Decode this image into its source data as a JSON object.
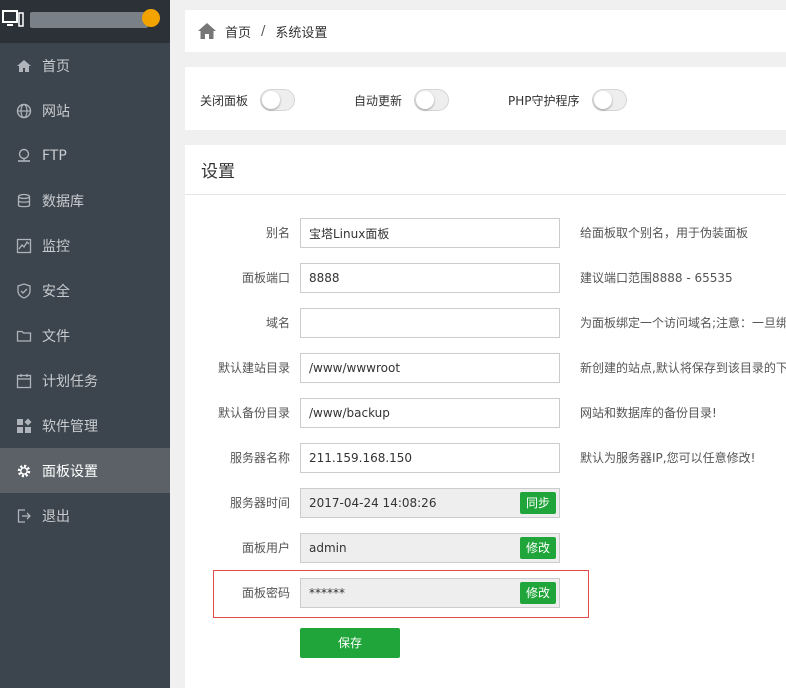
{
  "colors": {
    "sidebar": "#3c444d",
    "sidebar_top": "#2c3138",
    "active": "#5b6167",
    "accent": "#20a53a",
    "highlight": "#e14b4b"
  },
  "sidebar": {
    "items": [
      {
        "label": "首页",
        "icon": "home-icon"
      },
      {
        "label": "网站",
        "icon": "globe-icon"
      },
      {
        "label": "FTP",
        "icon": "ftp-icon"
      },
      {
        "label": "数据库",
        "icon": "database-icon"
      },
      {
        "label": "监控",
        "icon": "monitor-icon"
      },
      {
        "label": "安全",
        "icon": "shield-icon"
      },
      {
        "label": "文件",
        "icon": "folder-icon"
      },
      {
        "label": "计划任务",
        "icon": "calendar-icon"
      },
      {
        "label": "软件管理",
        "icon": "apps-icon"
      },
      {
        "label": "面板设置",
        "icon": "gear-icon",
        "active": true
      },
      {
        "label": "退出",
        "icon": "logout-icon"
      }
    ]
  },
  "breadcrumb": {
    "home": "首页",
    "sep": "/",
    "current": "系统设置"
  },
  "toggles": [
    {
      "label": "关闭面板",
      "on": false
    },
    {
      "label": "自动更新",
      "on": false
    },
    {
      "label": "PHP守护程序",
      "on": false
    }
  ],
  "settings": {
    "title": "设置",
    "rows": [
      {
        "label": "别名",
        "value": "宝塔Linux面板",
        "hint": "给面板取个别名，用于伪装面板"
      },
      {
        "label": "面板端口",
        "value": "8888",
        "hint": "建议端口范围8888 - 65535"
      },
      {
        "label": "域名",
        "value": "",
        "hint": "为面板绑定一个访问域名;注意：一旦绑"
      },
      {
        "label": "默认建站目录",
        "value": "/www/wwwroot",
        "hint": "新创建的站点,默认将保存到该目录的下"
      },
      {
        "label": "默认备份目录",
        "value": "/www/backup",
        "hint": "网站和数据库的备份目录!"
      },
      {
        "label": "服务器名称",
        "value": "211.159.168.150",
        "hint": "默认为服务器IP,您可以任意修改!"
      },
      {
        "label": "服务器时间",
        "value": "2017-04-24 14:08:26",
        "button": "同步"
      },
      {
        "label": "面板用户",
        "value": "admin",
        "button": "修改"
      },
      {
        "label": "面板密码",
        "value": "******",
        "button": "修改"
      }
    ],
    "save_label": "保存"
  }
}
